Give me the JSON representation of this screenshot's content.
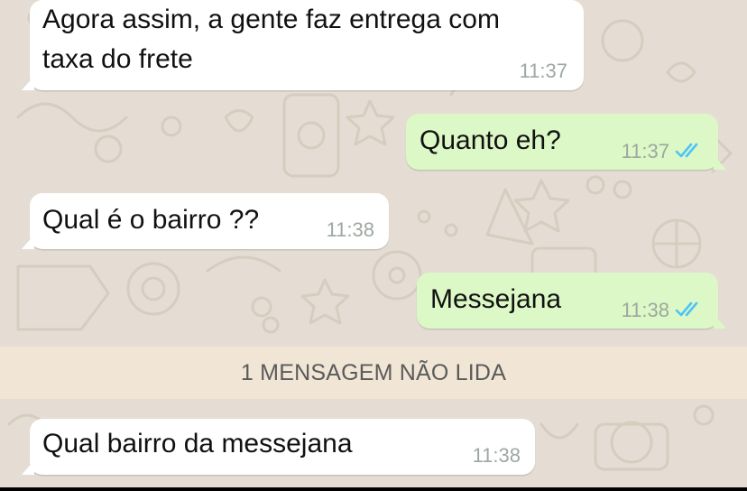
{
  "chat": {
    "messages": [
      {
        "direction": "in",
        "lines": [
          "Agora assim, a gente faz entrega com",
          "taxa do frete"
        ],
        "time": "11:37"
      },
      {
        "direction": "out",
        "lines": [
          "Quanto eh?"
        ],
        "time": "11:37",
        "status": "read",
        "status_icon": "double-check-icon"
      },
      {
        "direction": "in",
        "lines": [
          "Qual é o bairro ??"
        ],
        "time": "11:38"
      },
      {
        "direction": "out",
        "lines": [
          "Messejana"
        ],
        "time": "11:38",
        "status": "read",
        "status_icon": "double-check-icon"
      },
      {
        "direction": "in",
        "lines": [
          "Qual bairro da messejana"
        ],
        "time": "11:38"
      }
    ],
    "unread_banner": "1 MENSAGEM NÃO LIDA"
  },
  "colors": {
    "wallpaper": "#e5ddd3",
    "incoming_bubble": "#ffffff",
    "outgoing_bubble": "#dcf8c6",
    "read_ticks": "#4fc3f7",
    "unread_banner_bg": "#f1e5d5",
    "timestamp": "#9ea7a0"
  }
}
